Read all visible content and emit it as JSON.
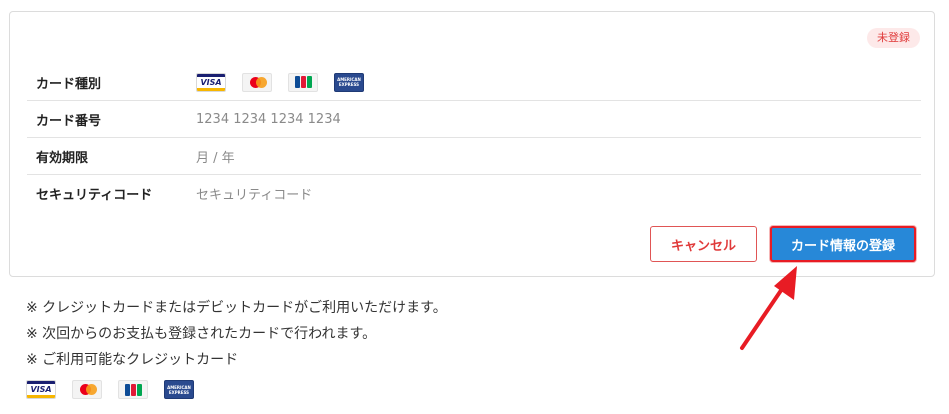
{
  "status_badge": "未登録",
  "form": {
    "card_type_label": "カード種別",
    "card_number_label": "カード番号",
    "card_number_placeholder": "1234 1234 1234 1234",
    "expiry_label": "有効期限",
    "expiry_placeholder": "月 / 年",
    "security_code_label": "セキュリティコード",
    "security_code_placeholder": "セキュリティコード"
  },
  "brands": {
    "visa": "VISA",
    "amex": "AMERICAN EXPRESS"
  },
  "buttons": {
    "cancel": "キャンセル",
    "register": "カード情報の登録"
  },
  "notes": [
    "※ クレジットカードまたはデビットカードがご利用いただけます。",
    "※ 次回からのお支払も登録されたカードで行われます。",
    "※ ご利用可能なクレジットカード"
  ],
  "icons": {
    "visa": "visa-card-icon",
    "mastercard": "mastercard-icon",
    "jcb": "jcb-card-icon",
    "amex": "amex-card-icon",
    "arrow": "red-arrow-annotation"
  },
  "colors": {
    "primary_button": "#2788d8",
    "cancel_border": "#e05555",
    "badge_bg": "#fde9e9",
    "badge_text": "#e03a3a",
    "annotation_red": "#e81c24"
  }
}
